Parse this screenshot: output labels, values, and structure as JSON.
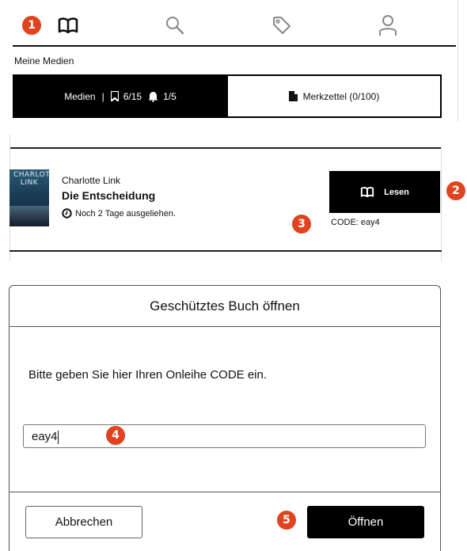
{
  "nav": {
    "items": [
      {
        "icon": "book-icon"
      },
      {
        "icon": "search-icon"
      },
      {
        "icon": "tag-icon"
      },
      {
        "icon": "user-icon"
      }
    ]
  },
  "section_title": "Meine Medien",
  "segments": {
    "medien_label": "Medien",
    "separator": "|",
    "bookmark_count": "6/15",
    "reminder_count": "1/5",
    "merkzettel_label": "Merkzettel (0/100)"
  },
  "book": {
    "cover_text": "CHARLOTTE LINK",
    "author": "Charlotte Link",
    "title": "Die Entscheidung",
    "loan_status": "Noch 2 Tage ausgeliehen.",
    "read_button": "Lesen",
    "code_text": "CODE: eay4"
  },
  "dialog": {
    "title": "Geschütztes Buch öffnen",
    "prompt": "Bitte geben Sie hier Ihren Onleihe CODE ein.",
    "input_value": "eay4",
    "cancel_button": "Abbrechen",
    "open_button": "Öffnen"
  },
  "badges": [
    "1",
    "2",
    "3",
    "4",
    "5"
  ],
  "colors": {
    "badge": "#e0441e",
    "primary_button": "#000000"
  }
}
